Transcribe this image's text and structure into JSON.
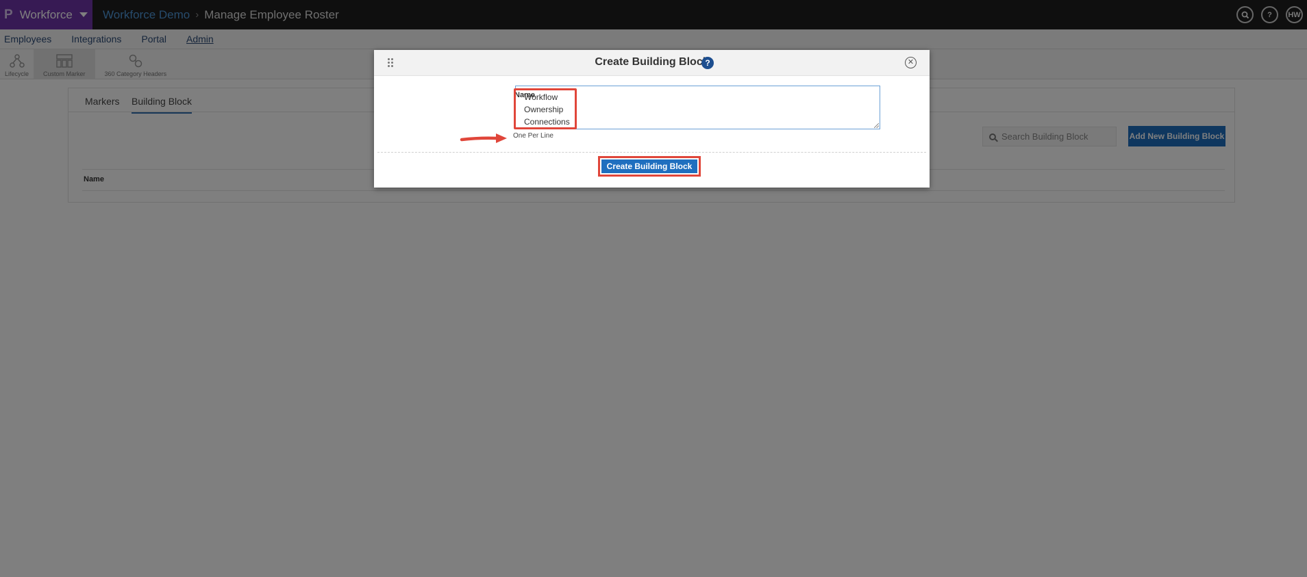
{
  "topbar": {
    "app_name": "Workforce",
    "logo_glyph": "P",
    "breadcrumb_root": "Workforce Demo",
    "breadcrumb_separator": "›",
    "breadcrumb_current": "Manage Employee Roster",
    "search_icon": "🔍",
    "help_label": "?",
    "avatar_initials": "HW"
  },
  "nav": {
    "items": [
      "Employees",
      "Integrations",
      "Portal",
      "Admin"
    ],
    "active": "Admin"
  },
  "toolbar": {
    "items": [
      "Lifecycle",
      "Custom Marker",
      "360 Category Headers"
    ],
    "selected": "Custom Marker"
  },
  "panel": {
    "tabs": [
      "Markers",
      "Building Block"
    ],
    "active_tab": "Building Block",
    "search_placeholder": "Search Building Block",
    "add_button": "Add New Building Block",
    "column_name": "Name"
  },
  "modal": {
    "title": "Create Building Block",
    "help_label": "?",
    "close_label": "✕",
    "name_label": "Name",
    "textarea_lines": [
      "Workflow",
      "Ownership",
      "Connections"
    ],
    "hint": "One Per Line",
    "submit_label": "Create Building Block"
  },
  "colors": {
    "accent": "#1f6fbf",
    "app_switcher": "#6e35a8",
    "highlight": "#e0463a",
    "topbar": "#1e1e1e"
  }
}
